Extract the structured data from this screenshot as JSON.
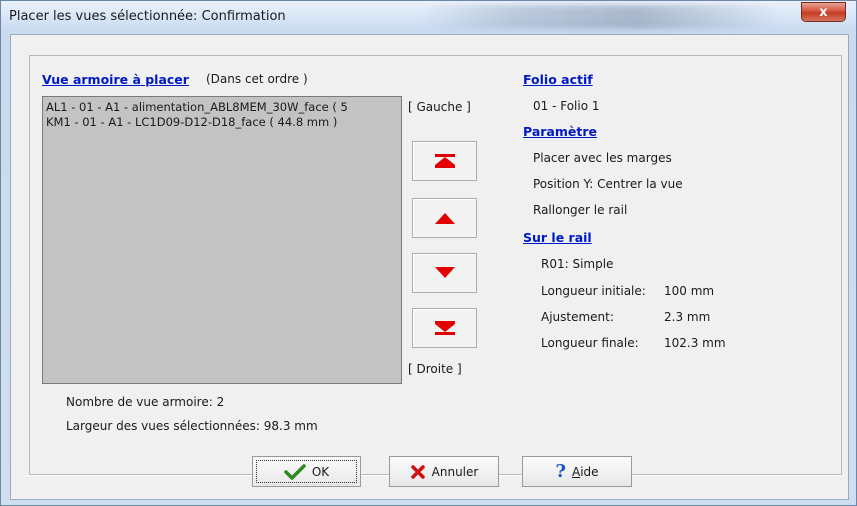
{
  "window": {
    "title": "Placer les vues sélectionnée: Confirmation",
    "close_label": "x"
  },
  "left": {
    "header": "Vue armoire à placer",
    "header_note": "(Dans cet ordre )",
    "list_items": [
      "AL1 - 01 - A1 - alimentation_ABL8MEM_30W_face ( 5",
      "KM1 - 01 - A1 - LC1D09-D12-D18_face ( 44.8 mm )"
    ],
    "count_text": "Nombre de vue armoire: 2",
    "width_text": "Largeur des vues sélectionnées: 98.3 mm"
  },
  "middle": {
    "left_label": "[ Gauche ]",
    "right_label": "[ Droite ]"
  },
  "right": {
    "folio_header": "Folio actif",
    "folio_value": "01 - Folio 1",
    "param_header": "Paramètre",
    "params": [
      "Placer avec les marges",
      "Position Y: Centrer la vue",
      "Rallonger le rail"
    ],
    "rail_header": "Sur le rail",
    "rail_name": "R01: Simple",
    "rail_rows": [
      {
        "label": "Longueur initiale:",
        "value": "100 mm"
      },
      {
        "label": "Ajustement:",
        "value": "2.3 mm"
      },
      {
        "label": "Longueur finale:",
        "value": "102.3 mm"
      }
    ]
  },
  "buttons": {
    "ok": "OK",
    "cancel": "Annuler",
    "help_prefix": "A",
    "help_rest": "ide"
  },
  "colors": {
    "header_blue": "#0019c8",
    "arrow_red": "#e30000",
    "check_green": "#2e8b1f"
  }
}
